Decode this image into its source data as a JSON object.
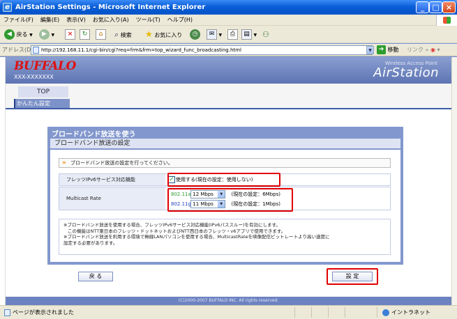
{
  "window": {
    "title": "AirStation Settings - Microsoft Internet Explorer"
  },
  "menu": [
    "ファイル(F)",
    "編集(E)",
    "表示(V)",
    "お気に入り(A)",
    "ツール(T)",
    "ヘルプ(H)"
  ],
  "toolbar": {
    "back": "戻る",
    "search": "検索",
    "favorites": "お気に入り"
  },
  "address": {
    "label": "アドレス(D)",
    "url": "http://192.168.11.1/cgi-bin/cgi?req=frm&frm=top_wizard_func_broadcasting.html",
    "go": "移動",
    "links": "リンク"
  },
  "header": {
    "logo": "BUFFALO",
    "model": "XXX-XXXXXXX",
    "wap": "Wireless Access Point",
    "product": "AirStation"
  },
  "nav": {
    "top": "TOP",
    "sub": "かんたん設定"
  },
  "panel": {
    "title": "ブロードバンド放送を使う",
    "subtitle": "ブロードバンド放送の設定",
    "instruction": "ブロードバンド放送の設定を行ってください。",
    "ipv6": {
      "label": "フレッツIPv6サービス対応機能",
      "checked": true,
      "checkbox_text": "使用する(現在の設定：使用しない)"
    },
    "multicast": {
      "label": "Multicast Rate",
      "rows": [
        {
          "band": "802.11a",
          "band_color": "#2e9b2e",
          "value": "12 Mbps",
          "current": "(現在の設定：6Mbps)"
        },
        {
          "band": "802.11g",
          "band_color": "#1f3fbf",
          "value": "11 Mbps",
          "current": "(現在の設定：1Mbps)"
        }
      ]
    },
    "notes": [
      "※ブロードバンド放送を使用する場合、フレッツIPv6サービス対応機能(IPv6パススルー)を有効にします。",
      "この機能はNTT東日本のフレッツ・ドットネットおよびNTT西日本のフレッツ・v6アプリで使用できます。",
      "※ブロードバンド放送を利用する環境で無線LANパソコンを使用する場合、MulticastRateを映像配信ビットレートより高い速度に",
      "設定する必要があります。"
    ]
  },
  "buttons": {
    "back": "戻 る",
    "submit": "設 定"
  },
  "footer": "(C)2000-2007 BUFFALO INC. All rights reserved.",
  "status": {
    "text": "ページが表示されました",
    "zone": "イントラネット"
  }
}
